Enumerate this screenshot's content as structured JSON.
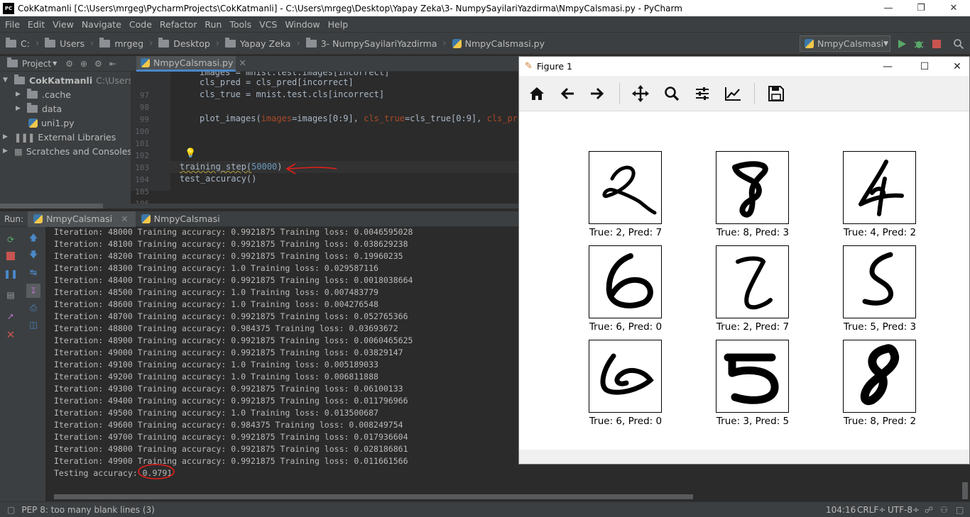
{
  "window": {
    "title": "CokKatmanli [C:\\Users\\mrgeg\\PycharmProjects\\CokKatmanli] - C:\\Users\\mrgeg\\Desktop\\Yapay Zeka\\3- NumpySayilariYazdirma\\NmpyCalsmasi.py - PyCharm",
    "app_icon": "PC"
  },
  "menu": [
    "File",
    "Edit",
    "View",
    "Navigate",
    "Code",
    "Refactor",
    "Run",
    "Tools",
    "VCS",
    "Window",
    "Help"
  ],
  "breadcrumbs": [
    "C:",
    "Users",
    "mrgeg",
    "Desktop",
    "Yapay Zeka",
    "3- NumpySayilariYazdirma",
    "NmpyCalsmasi.py"
  ],
  "run_config": "NmpyCalsmasi",
  "project": {
    "header": "Project",
    "tree": [
      {
        "label": "CokKatmanli",
        "hint": "C:\\Users\\mrg",
        "type": "root-folder"
      },
      {
        "label": ".cache",
        "type": "folder"
      },
      {
        "label": "data",
        "type": "folder"
      },
      {
        "label": "uni1.py",
        "type": "python-file"
      },
      {
        "label": "External Libraries",
        "type": "library"
      },
      {
        "label": "Scratches and Consoles",
        "type": "scratches"
      }
    ]
  },
  "editor": {
    "tab": "NmpyCalsmasi.py",
    "line_numbers": [
      "97",
      "98",
      "99",
      "100",
      "101",
      "102",
      "103",
      "104",
      "105",
      "106"
    ],
    "lines": {
      "l96": "images = mnist.test.images[incorrect]",
      "l97": "cls_pred = cls_pred[incorrect]",
      "l98": "cls_true = mnist.test.cls[incorrect]",
      "l100_a": "plot_images(",
      "l100_b": "images",
      "l100_c": "=images[0:9], ",
      "l100_d": "cls_true",
      "l100_e": "=cls_true[0:9], ",
      "l100_f": "cls_pred",
      "l104_a": "training_step(",
      "l104_b": "50000",
      "l104_c": ")",
      "l105": "test_accuracy()"
    }
  },
  "run": {
    "label": "Run:",
    "tabs": [
      "NmpyCalsmasi",
      "NmpyCalsmasi"
    ],
    "console": [
      "Iteration: 48000 Training accuracy: 0.9921875 Training loss: 0.0046595028",
      "Iteration: 48100 Training accuracy: 0.9921875 Training loss: 0.038629238",
      "Iteration: 48200 Training accuracy: 0.9921875 Training loss: 0.19960235",
      "Iteration: 48300 Training accuracy: 1.0 Training loss: 0.029587116",
      "Iteration: 48400 Training accuracy: 0.9921875 Training loss: 0.0018038664",
      "Iteration: 48500 Training accuracy: 1.0 Training loss: 0.007483779",
      "Iteration: 48600 Training accuracy: 1.0 Training loss: 0.004276548",
      "Iteration: 48700 Training accuracy: 0.9921875 Training loss: 0.052765366",
      "Iteration: 48800 Training accuracy: 0.984375 Training loss: 0.03693672",
      "Iteration: 48900 Training accuracy: 0.9921875 Training loss: 0.0060465625",
      "Iteration: 49000 Training accuracy: 0.9921875 Training loss: 0.03829147",
      "Iteration: 49100 Training accuracy: 1.0 Training loss: 0.005189033",
      "Iteration: 49200 Training accuracy: 1.0 Training loss: 0.006811888",
      "Iteration: 49300 Training accuracy: 0.9921875 Training loss: 0.06100133",
      "Iteration: 49400 Training accuracy: 0.9921875 Training loss: 0.011796966",
      "Iteration: 49500 Training accuracy: 1.0 Training loss: 0.013500687",
      "Iteration: 49600 Training accuracy: 0.984375 Training loss: 0.008249754",
      "Iteration: 49700 Training accuracy: 0.9921875 Training loss: 0.017936604",
      "Iteration: 49800 Training accuracy: 0.9921875 Training loss: 0.028186861",
      "Iteration: 49900 Training accuracy: 0.9921875 Training loss: 0.011661566"
    ],
    "testing_label": "Testing accuracy: ",
    "testing_value": "0.9791"
  },
  "status": {
    "message": "PEP 8: too many blank lines (3)",
    "position": "104:16",
    "line_sep": "CRLF÷",
    "encoding": "UTF-8÷"
  },
  "figure": {
    "title": "Figure 1",
    "captions": [
      "True: 2, Pred: 7",
      "True: 8, Pred: 3",
      "True: 4, Pred: 2",
      "True: 6, Pred: 0",
      "True: 2, Pred: 7",
      "True: 5, Pred: 3",
      "True: 6, Pred: 0",
      "True: 3, Pred: 5",
      "True: 8, Pred: 2"
    ],
    "toolbar_icons": [
      "home-icon",
      "back-arrow-icon",
      "forward-arrow-icon",
      "pan-icon",
      "zoom-icon",
      "configure-subplots-icon",
      "edit-axis-icon",
      "save-icon"
    ]
  },
  "colors": {
    "ide_bg": "#2b2b2b",
    "panel_bg": "#3c3f41",
    "annotation_red": "#e0201a",
    "accent_blue": "#4a88c7"
  }
}
